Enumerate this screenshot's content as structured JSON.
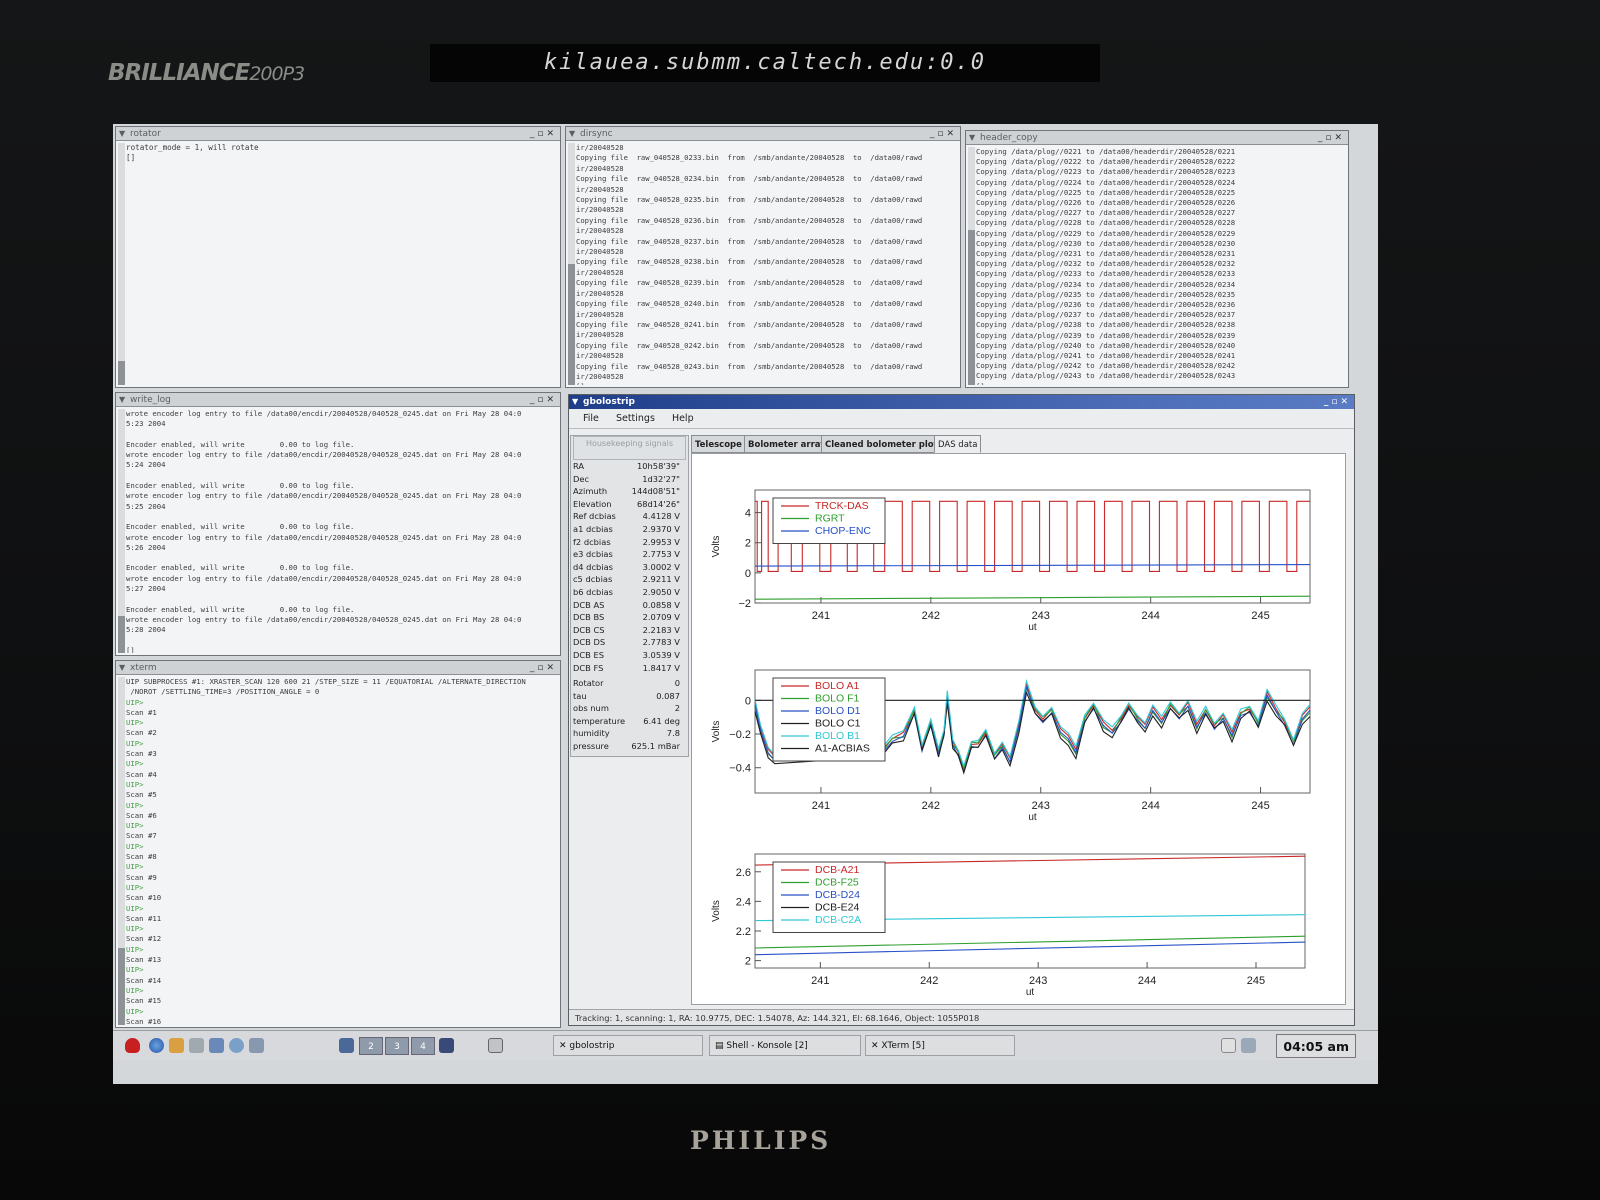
{
  "monitor": {
    "brand": "BRILLIANCE",
    "model": "200P3",
    "display_title": "kilauea.submm.caltech.edu:0.0",
    "logo": "PHILIPS"
  },
  "windows": {
    "rotator": {
      "title": "rotator",
      "lines": [
        "rotator_mode = 1, will rotate",
        "[]"
      ]
    },
    "dirsync": {
      "title": "dirsync",
      "lines": [
        "ir/20040528",
        "Copying file  raw_040528_0233.bin  from  /smb/andante/20040528  to  /data00/rawd",
        "ir/20040528",
        "Copying file  raw_040528_0234.bin  from  /smb/andante/20040528  to  /data00/rawd",
        "ir/20040528",
        "Copying file  raw_040528_0235.bin  from  /smb/andante/20040528  to  /data00/rawd",
        "ir/20040528",
        "Copying file  raw_040528_0236.bin  from  /smb/andante/20040528  to  /data00/rawd",
        "ir/20040528",
        "Copying file  raw_040528_0237.bin  from  /smb/andante/20040528  to  /data00/rawd",
        "ir/20040528",
        "Copying file  raw_040528_0238.bin  from  /smb/andante/20040528  to  /data00/rawd",
        "ir/20040528",
        "Copying file  raw_040528_0239.bin  from  /smb/andante/20040528  to  /data00/rawd",
        "ir/20040528",
        "Copying file  raw_040528_0240.bin  from  /smb/andante/20040528  to  /data00/rawd",
        "ir/20040528",
        "Copying file  raw_040528_0241.bin  from  /smb/andante/20040528  to  /data00/rawd",
        "ir/20040528",
        "Copying file  raw_040528_0242.bin  from  /smb/andante/20040528  to  /data00/rawd",
        "ir/20040528",
        "Copying file  raw_040528_0243.bin  from  /smb/andante/20040528  to  /data00/rawd",
        "ir/20040528",
        "[]"
      ]
    },
    "header_copy": {
      "title": "header_copy",
      "lines": [
        "Copying /data/plog//0221 to /data00/headerdir/20040528/0221",
        "Copying /data/plog//0222 to /data00/headerdir/20040528/0222",
        "Copying /data/plog//0223 to /data00/headerdir/20040528/0223",
        "Copying /data/plog//0224 to /data00/headerdir/20040528/0224",
        "Copying /data/plog//0225 to /data00/headerdir/20040528/0225",
        "Copying /data/plog//0226 to /data00/headerdir/20040528/0226",
        "Copying /data/plog//0227 to /data00/headerdir/20040528/0227",
        "Copying /data/plog//0228 to /data00/headerdir/20040528/0228",
        "Copying /data/plog//0229 to /data00/headerdir/20040528/0229",
        "Copying /data/plog//0230 to /data00/headerdir/20040528/0230",
        "Copying /data/plog//0231 to /data00/headerdir/20040528/0231",
        "Copying /data/plog//0232 to /data00/headerdir/20040528/0232",
        "Copying /data/plog//0233 to /data00/headerdir/20040528/0233",
        "Copying /data/plog//0234 to /data00/headerdir/20040528/0234",
        "Copying /data/plog//0235 to /data00/headerdir/20040528/0235",
        "Copying /data/plog//0236 to /data00/headerdir/20040528/0236",
        "Copying /data/plog//0237 to /data00/headerdir/20040528/0237",
        "Copying /data/plog//0238 to /data00/headerdir/20040528/0238",
        "Copying /data/plog//0239 to /data00/headerdir/20040528/0239",
        "Copying /data/plog//0240 to /data00/headerdir/20040528/0240",
        "Copying /data/plog//0241 to /data00/headerdir/20040528/0241",
        "Copying /data/plog//0242 to /data00/headerdir/20040528/0242",
        "Copying /data/plog//0243 to /data00/headerdir/20040528/0243",
        "[]"
      ]
    },
    "write_log": {
      "title": "write_log",
      "lines": [
        "wrote encoder log entry to file /data00/encdir/20040528/040528_0245.dat on Fri May 28 04:0",
        "5:23 2004",
        "",
        "Encoder enabled, will write        0.00 to log file.",
        "wrote encoder log entry to file /data00/encdir/20040528/040528_0245.dat on Fri May 28 04:0",
        "5:24 2004",
        "",
        "Encoder enabled, will write        0.00 to log file.",
        "wrote encoder log entry to file /data00/encdir/20040528/040528_0245.dat on Fri May 28 04:0",
        "5:25 2004",
        "",
        "Encoder enabled, will write        0.00 to log file.",
        "wrote encoder log entry to file /data00/encdir/20040528/040528_0245.dat on Fri May 28 04:0",
        "5:26 2004",
        "",
        "Encoder enabled, will write        0.00 to log file.",
        "wrote encoder log entry to file /data00/encdir/20040528/040528_0245.dat on Fri May 28 04:0",
        "5:27 2004",
        "",
        "Encoder enabled, will write        0.00 to log file.",
        "wrote encoder log entry to file /data00/encdir/20040528/040528_0245.dat on Fri May 28 04:0",
        "5:28 2004",
        "",
        "[]"
      ]
    },
    "xterm": {
      "title": "xterm",
      "lines": [
        "UIP SUBPROCESS #1: XRASTER_SCAN 120 600 21 /STEP_SIZE = 11 /EQUATORIAL /ALTERNATE_DIRECTION",
        " /NOROT /SETTLING_TIME=3 /POSITION_ANGLE = 0",
        "UIP>",
        "Scan #1",
        "UIP>",
        "Scan #2",
        "UIP>",
        "Scan #3",
        "UIP>",
        "Scan #4",
        "UIP>",
        "Scan #5",
        "UIP>",
        "Scan #6",
        "UIP>",
        "Scan #7",
        "UIP>",
        "Scan #8",
        "UIP>",
        "Scan #9",
        "UIP>",
        "Scan #10",
        "UIP>",
        "Scan #11",
        "UIP>",
        "Scan #12",
        "UIP>",
        "Scan #13",
        "UIP>",
        "Scan #14",
        "UIP>",
        "Scan #15",
        "UIP>",
        "Scan #16",
        "UIP> []"
      ]
    }
  },
  "gbolostrip": {
    "title": "gbolostrip",
    "menu": [
      "File",
      "Settings",
      "Help"
    ],
    "housekeeping_header": "Housekeeping signals",
    "housekeeping": [
      {
        "label": "RA",
        "value": "10h58'39\""
      },
      {
        "label": "Dec",
        "value": "1d32'27\""
      },
      {
        "label": "Azimuth",
        "value": "144d08'51\""
      },
      {
        "label": "Elevation",
        "value": "68d14'26\""
      },
      {
        "label": "Ref dcbias",
        "value": "4.4128 V"
      },
      {
        "label": "a1 dcbias",
        "value": "2.9370 V"
      },
      {
        "label": "f2 dcbias",
        "value": "2.9953 V"
      },
      {
        "label": "e3 dcbias",
        "value": "2.7753 V"
      },
      {
        "label": "d4 dcbias",
        "value": "3.0002 V"
      },
      {
        "label": "c5 dcbias",
        "value": "2.9211 V"
      },
      {
        "label": "b6 dcbias",
        "value": "2.9050 V"
      },
      {
        "label": "DCB AS",
        "value": "0.0858 V"
      },
      {
        "label": "DCB BS",
        "value": "2.0709 V"
      },
      {
        "label": "DCB CS",
        "value": "2.2183 V"
      },
      {
        "label": "DCB DS",
        "value": "2.7783 V"
      },
      {
        "label": "DCB ES",
        "value": "3.0539 V"
      },
      {
        "label": "DCB FS",
        "value": "1.8417 V"
      },
      {
        "label": "Rotator",
        "value": "0"
      },
      {
        "label": "tau",
        "value": "0.087"
      },
      {
        "label": "obs num",
        "value": "2"
      },
      {
        "label": "temperature",
        "value": "6.41 deg"
      },
      {
        "label": "humidity",
        "value": "7.8"
      },
      {
        "label": "pressure",
        "value": "625.1 mBar"
      }
    ],
    "tabs": [
      "Telescope",
      "Bolometer array",
      "Cleaned bolometer plots",
      "DAS data"
    ],
    "active_tab": "DAS data",
    "status": "Tracking: 1, scanning: 1, RA: 10.9775, DEC: 1.54078, Az: 144.321, El: 68.1646,  Object: 1055P018"
  },
  "taskbar": {
    "pagers": [
      "2",
      "3",
      "4"
    ],
    "tasks": [
      "gbolostrip",
      "Shell - Konsole [2]",
      "XTerm [5]"
    ],
    "clock": "04:05 am"
  },
  "chart_data": [
    {
      "type": "line",
      "xlabel": "ut",
      "ylabel": "Volts",
      "xlim": [
        240.4,
        245.45
      ],
      "ylim": [
        -2,
        5.5
      ],
      "xticks": [
        241,
        242,
        243,
        244,
        245
      ],
      "yticks": [
        -2,
        0,
        2,
        4
      ],
      "legend_position": "top-left",
      "series": [
        {
          "name": "TRCK-DAS",
          "color": "#c82828",
          "type": "square",
          "high": 4.75,
          "low": 0.1,
          "edges": [
            240.42,
            240.46,
            240.52,
            240.61,
            240.73,
            240.83,
            240.99,
            241.09,
            241.24,
            241.33,
            241.48,
            241.58,
            241.74,
            241.83,
            241.99,
            242.08,
            242.24,
            242.33,
            242.49,
            242.58,
            242.74,
            242.83,
            242.99,
            243.08,
            243.24,
            243.33,
            243.49,
            243.58,
            243.74,
            243.83,
            243.99,
            244.08,
            244.24,
            244.33,
            244.49,
            244.58,
            244.74,
            244.83,
            244.99,
            245.08,
            245.24,
            245.33
          ]
        },
        {
          "name": "RGRT",
          "color": "#2e9e2e",
          "values": [
            [
              240.4,
              -1.75
            ],
            [
              245.45,
              -1.55
            ]
          ]
        },
        {
          "name": "CHOP-ENC",
          "color": "#2850c8",
          "values": [
            [
              240.4,
              0.45
            ],
            [
              245.45,
              0.55
            ]
          ]
        }
      ]
    },
    {
      "type": "line",
      "xlabel": "ut",
      "ylabel": "Volts",
      "xlim": [
        240.4,
        245.45
      ],
      "ylim": [
        -0.55,
        0.18
      ],
      "xticks": [
        241,
        242,
        243,
        244,
        245
      ],
      "yticks": [
        -0.4,
        -0.2,
        0.0
      ],
      "legend_position": "top-left",
      "gap": [
        240.6,
        241.55
      ],
      "series": [
        {
          "name": "BOLO A1",
          "color": "#c82828",
          "offset": 0.0
        },
        {
          "name": "BOLO F1",
          "color": "#2e9e2e",
          "offset": -0.01
        },
        {
          "name": "BOLO D1",
          "color": "#2850c8",
          "offset": -0.02
        },
        {
          "name": "BOLO C1",
          "color": "#202020",
          "offset": -0.035
        },
        {
          "name": "BOLO B1",
          "color": "#30c8d8",
          "offset": 0.015
        },
        {
          "name": "A1-ACBIAS",
          "color": "#202020",
          "values": [
            [
              240.4,
              0.0
            ],
            [
              245.45,
              0.0
            ]
          ]
        }
      ],
      "base_curve": [
        [
          240.4,
          -0.02
        ],
        [
          240.45,
          -0.16
        ],
        [
          240.52,
          -0.3
        ],
        [
          240.58,
          -0.34
        ],
        [
          241.55,
          -0.3
        ],
        [
          241.65,
          -0.22
        ],
        [
          241.75,
          -0.2
        ],
        [
          241.85,
          -0.05
        ],
        [
          241.92,
          -0.27
        ],
        [
          242.0,
          -0.12
        ],
        [
          242.07,
          -0.3
        ],
        [
          242.12,
          -0.18
        ],
        [
          242.15,
          0.03
        ],
        [
          242.2,
          -0.25
        ],
        [
          242.25,
          -0.3
        ],
        [
          242.3,
          -0.4
        ],
        [
          242.37,
          -0.25
        ],
        [
          242.43,
          -0.25
        ],
        [
          242.5,
          -0.18
        ],
        [
          242.58,
          -0.32
        ],
        [
          242.65,
          -0.26
        ],
        [
          242.72,
          -0.35
        ],
        [
          242.8,
          -0.15
        ],
        [
          242.87,
          0.09
        ],
        [
          242.95,
          -0.05
        ],
        [
          243.02,
          -0.1
        ],
        [
          243.1,
          -0.05
        ],
        [
          243.18,
          -0.18
        ],
        [
          243.25,
          -0.22
        ],
        [
          243.32,
          -0.3
        ],
        [
          243.4,
          -0.1
        ],
        [
          243.48,
          -0.02
        ],
        [
          243.57,
          -0.14
        ],
        [
          243.65,
          -0.18
        ],
        [
          243.73,
          -0.1
        ],
        [
          243.8,
          -0.02
        ],
        [
          243.88,
          -0.1
        ],
        [
          243.95,
          -0.15
        ],
        [
          244.02,
          -0.05
        ],
        [
          244.1,
          -0.12
        ],
        [
          244.18,
          -0.02
        ],
        [
          244.26,
          -0.08
        ],
        [
          244.34,
          -0.02
        ],
        [
          244.42,
          -0.15
        ],
        [
          244.5,
          -0.05
        ],
        [
          244.58,
          -0.14
        ],
        [
          244.66,
          -0.09
        ],
        [
          244.74,
          -0.2
        ],
        [
          244.82,
          -0.07
        ],
        [
          244.9,
          -0.04
        ],
        [
          244.98,
          -0.13
        ],
        [
          245.06,
          0.04
        ],
        [
          245.14,
          -0.05
        ],
        [
          245.22,
          -0.12
        ],
        [
          245.3,
          -0.24
        ],
        [
          245.38,
          -0.1
        ],
        [
          245.45,
          -0.05
        ]
      ]
    },
    {
      "type": "line",
      "xlabel": "ut",
      "ylabel": "Volts",
      "xlim": [
        240.4,
        245.45
      ],
      "ylim": [
        1.95,
        2.72
      ],
      "xticks": [
        241,
        242,
        243,
        244,
        245
      ],
      "yticks": [
        2.0,
        2.2,
        2.4,
        2.6
      ],
      "legend_position": "top-left",
      "series": [
        {
          "name": "DCB-A21",
          "color": "#c82828",
          "values": [
            [
              240.4,
              2.645
            ],
            [
              245.45,
              2.705
            ]
          ]
        },
        {
          "name": "DCB-F25",
          "color": "#2e9e2e",
          "values": [
            [
              240.4,
              2.085
            ],
            [
              245.45,
              2.165
            ]
          ]
        },
        {
          "name": "DCB-D24",
          "color": "#2850c8",
          "values": [
            [
              240.4,
              2.04
            ],
            [
              245.45,
              2.125
            ]
          ]
        },
        {
          "name": "DCB-E24",
          "color": "#202020",
          "values": []
        },
        {
          "name": "DCB-C2A",
          "color": "#30c8d8",
          "values": [
            [
              240.4,
              2.27
            ],
            [
              245.45,
              2.31
            ]
          ]
        }
      ]
    }
  ]
}
